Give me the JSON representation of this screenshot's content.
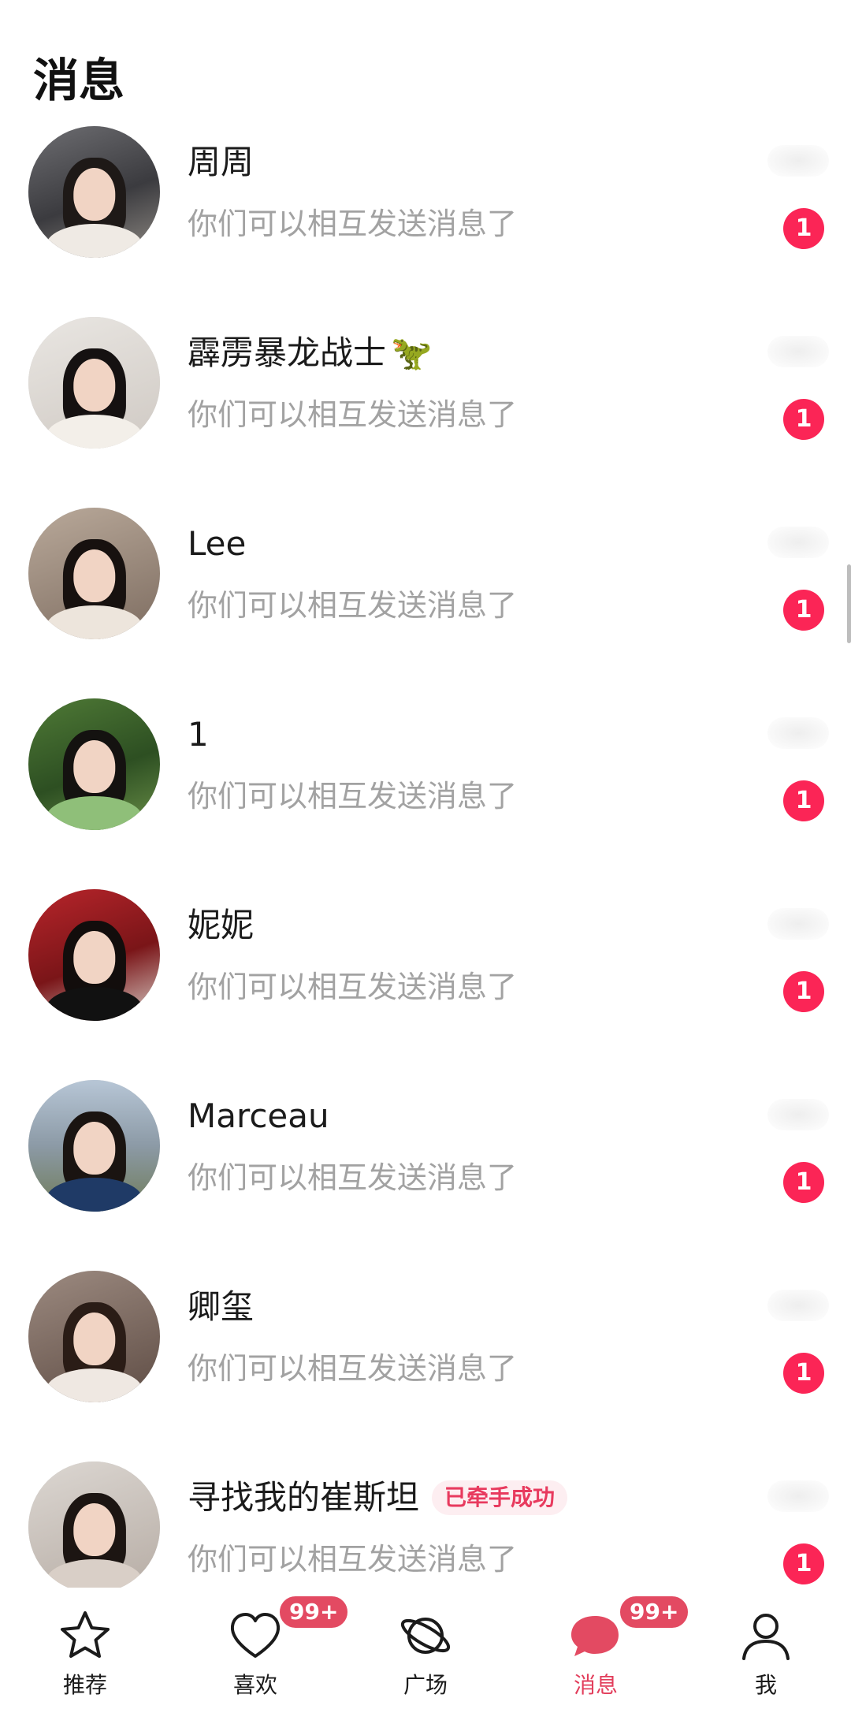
{
  "header": {
    "title": "消息"
  },
  "conversations": [
    {
      "name": "周周",
      "preview": "你们可以相互发送消息了",
      "unread": "1",
      "tag": "",
      "emoji": "",
      "avatar": {
        "bg": "linear-gradient(160deg,#6e6e72 0%,#3b3b3f 55%,#8f8a84 100%)",
        "hair": "#1e1917",
        "body": "#efeae4"
      }
    },
    {
      "name": "霹雳暴龙战士",
      "preview": "你们可以相互发送消息了",
      "unread": "1",
      "tag": "",
      "emoji": "🦖",
      "avatar": {
        "bg": "linear-gradient(160deg,#e9e6e2 0%,#cfc9c3 100%)",
        "hair": "#151111",
        "body": "#f3efe9"
      }
    },
    {
      "name": "Lee",
      "preview": "你们可以相互发送消息了",
      "unread": "1",
      "tag": "",
      "emoji": "",
      "avatar": {
        "bg": "linear-gradient(160deg,#b9a99a 0%,#7d6c60 100%)",
        "hair": "#17110f",
        "body": "#ede5dc"
      }
    },
    {
      "name": "1",
      "preview": "你们可以相互发送消息了",
      "unread": "1",
      "tag": "",
      "emoji": "",
      "avatar": {
        "bg": "linear-gradient(160deg,#4f7a36 0%,#2d4f22 55%,#6a8f48 100%)",
        "hair": "#141210",
        "body": "#8fbf79"
      }
    },
    {
      "name": "妮妮",
      "preview": "你们可以相互发送消息了",
      "unread": "1",
      "tag": "",
      "emoji": "",
      "avatar": {
        "bg": "linear-gradient(160deg,#b8252b 0%,#7a1518 55%,#d8cfc8 100%)",
        "hair": "#120d0c",
        "body": "#111111"
      }
    },
    {
      "name": "Marceau",
      "preview": "你们可以相互发送消息了",
      "unread": "1",
      "tag": "",
      "emoji": "",
      "avatar": {
        "bg": "linear-gradient(180deg,#b7c6d6 0%,#8c9aa6 50%,#6f7b58 100%)",
        "hair": "#1a1411",
        "body": "#1f3a66"
      }
    },
    {
      "name": "卿玺",
      "preview": "你们可以相互发送消息了",
      "unread": "1",
      "tag": "",
      "emoji": "",
      "avatar": {
        "bg": "linear-gradient(160deg,#9c8a80 0%,#5e4c44 100%)",
        "hair": "#2a1c16",
        "body": "#efe8e2"
      }
    },
    {
      "name": "寻找我的崔斯坦",
      "preview": "你们可以相互发送消息了",
      "unread": "1",
      "tag": "已牵手成功",
      "emoji": "",
      "avatar": {
        "bg": "linear-gradient(160deg,#dcd7d2 0%,#b6aca4 100%)",
        "hair": "#1c1512",
        "body": "#d9cfc7"
      }
    }
  ],
  "tabbar": {
    "tabs": [
      {
        "label": "推荐",
        "icon": "star-icon",
        "badge": ""
      },
      {
        "label": "喜欢",
        "icon": "heart-icon",
        "badge": "99+"
      },
      {
        "label": "广场",
        "icon": "planet-icon",
        "badge": ""
      },
      {
        "label": "消息",
        "icon": "chat-bubble-icon",
        "badge": "99+",
        "active": true
      },
      {
        "label": "我",
        "icon": "person-icon",
        "badge": ""
      }
    ],
    "active_color": "#e23d5b"
  },
  "colors": {
    "unread_badge": "#fb2556",
    "preview_text": "#a2a2a2",
    "tag_text": "#e83a5e"
  }
}
